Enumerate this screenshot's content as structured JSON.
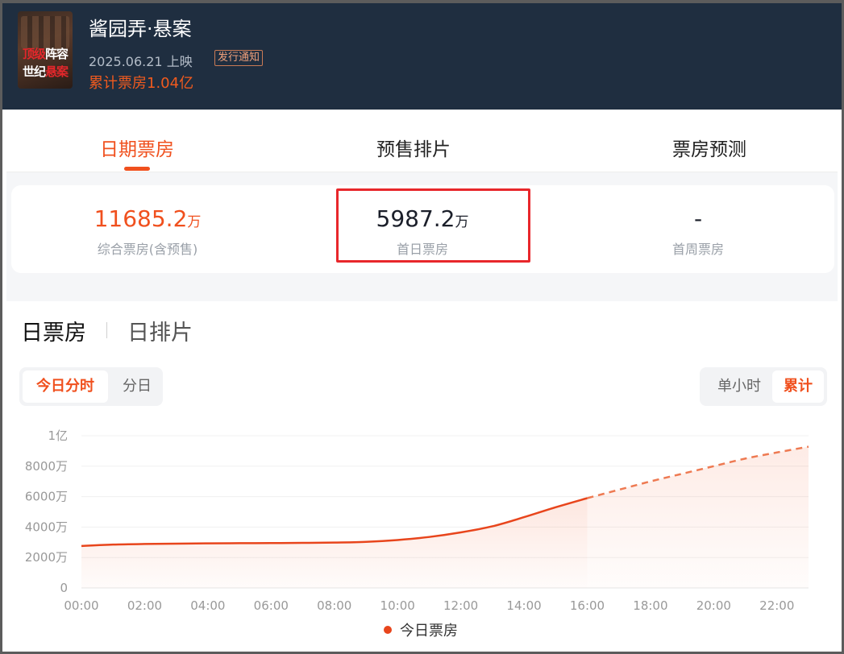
{
  "header": {
    "title": "酱园弄·悬案",
    "release_date": "2025.06.21 上映",
    "notice_badge": "发行通知",
    "total_box_office": "累计票房1.04亿",
    "poster_text_1": "阵容",
    "poster_text_1_red": "顶级",
    "poster_text_2": "世纪",
    "poster_text_2_red": "悬案"
  },
  "tabs": [
    {
      "label": "日期票房",
      "active": true
    },
    {
      "label": "预售排片",
      "active": false
    },
    {
      "label": "票房预测",
      "active": false
    }
  ],
  "stats": [
    {
      "value": "11685.2",
      "unit": "万",
      "label": "综合票房(含预售)"
    },
    {
      "value": "5987.2",
      "unit": "万",
      "label": "首日票房"
    },
    {
      "value": "-",
      "unit": "",
      "label": "首周票房"
    }
  ],
  "subtabs": [
    "日票房",
    "日排片"
  ],
  "segment_left": [
    "今日分时",
    "分日"
  ],
  "segment_right": [
    "单小时",
    "累计"
  ],
  "colors": {
    "accent": "#f0501e",
    "header_bg": "#1f2e40",
    "highlight": "#e8272b"
  },
  "chart_data": {
    "type": "line",
    "ylabels": [
      "0",
      "2000万",
      "4000万",
      "6000万",
      "8000万",
      "1亿"
    ],
    "yvalues": [
      0,
      2000,
      4000,
      6000,
      8000,
      10000
    ],
    "ylim": [
      0,
      10000
    ],
    "xlabels": [
      "00:00",
      "02:00",
      "04:00",
      "06:00",
      "08:00",
      "10:00",
      "12:00",
      "14:00",
      "16:00",
      "18:00",
      "20:00",
      "22:00"
    ],
    "xlim": [
      0,
      23
    ],
    "series": [
      {
        "name": "今日票房",
        "actual": [
          [
            0,
            2760
          ],
          [
            1,
            2850
          ],
          [
            2,
            2890
          ],
          [
            3,
            2910
          ],
          [
            4,
            2930
          ],
          [
            5,
            2940
          ],
          [
            6,
            2950
          ],
          [
            7,
            2960
          ],
          [
            8,
            2980
          ],
          [
            9,
            3030
          ],
          [
            10,
            3150
          ],
          [
            11,
            3350
          ],
          [
            12,
            3650
          ],
          [
            13,
            4050
          ],
          [
            14,
            4650
          ],
          [
            15,
            5300
          ],
          [
            16,
            5900
          ]
        ],
        "forecast": [
          [
            16,
            5900
          ],
          [
            17,
            6450
          ],
          [
            18,
            7000
          ],
          [
            19,
            7500
          ],
          [
            20,
            8000
          ],
          [
            21,
            8500
          ],
          [
            22,
            8900
          ],
          [
            23,
            9280
          ]
        ]
      }
    ]
  }
}
